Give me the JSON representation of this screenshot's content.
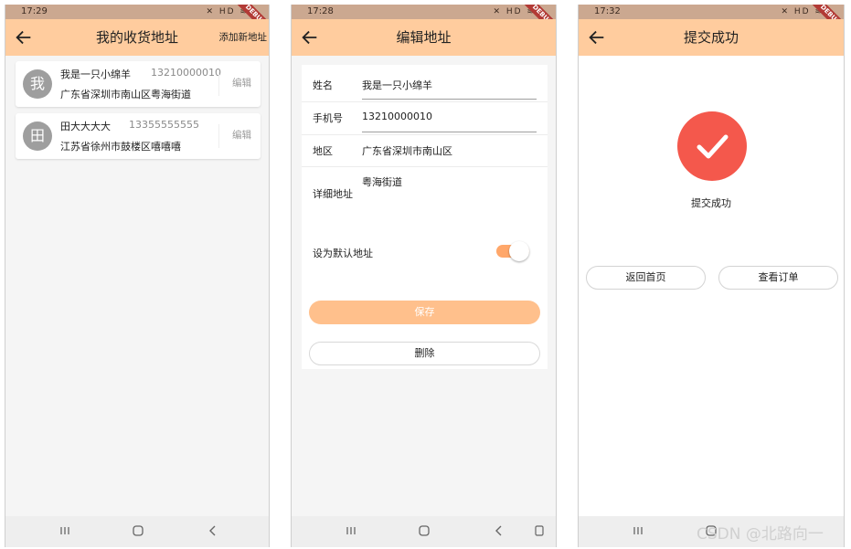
{
  "colors": {
    "appbar": "#ffcc9e",
    "accent": "#ffa76a",
    "save_button": "#ffc08c",
    "success": "#f4584c",
    "statusbar": "#cba890"
  },
  "status_icons": "✕ HD ≋",
  "debug_banner": "DEBUG",
  "screen1": {
    "time": "17:29",
    "title": "我的收货地址",
    "action": "添加新地址",
    "addresses": [
      {
        "avatar": "我",
        "name": "我是一只小绵羊",
        "phone": "13210000010",
        "address": "广东省深圳市南山区粤海街道",
        "edit": "编辑"
      },
      {
        "avatar": "田",
        "name": "田大大大大",
        "phone": "13355555555",
        "address": "江苏省徐州市鼓楼区嘻嘻嘻",
        "edit": "编辑"
      }
    ]
  },
  "screen2": {
    "time": "17:28",
    "title": "编辑地址",
    "form": {
      "name_label": "姓名",
      "name_value": "我是一只小绵羊",
      "phone_label": "手机号",
      "phone_value": "13210000010",
      "region_label": "地区",
      "region_value": "广东省深圳市南山区",
      "detail_label": "详细地址",
      "detail_value": "粤海街道",
      "default_label": "设为默认地址",
      "default_on": true
    },
    "save": "保存",
    "delete": "删除"
  },
  "screen3": {
    "time": "17:32",
    "title": "提交成功",
    "message": "提交成功",
    "home_button": "返回首页",
    "order_button": "查看订单"
  },
  "watermark": "CSDN @北路向一"
}
